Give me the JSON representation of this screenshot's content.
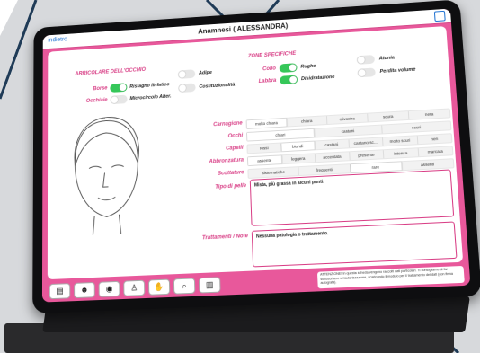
{
  "window": {
    "title": "Anamnesi ( ALESSANDRA)",
    "back_label": "indietro"
  },
  "sections": {
    "eye_area": "ARRICOLARE DELL'OCCHIO",
    "specific_zones": "ZONE SPECIFICHE"
  },
  "eye_toggles": [
    {
      "side_label": "Borse",
      "on": true,
      "label": "Ristagno linfatico"
    },
    {
      "side_label": "Occhiaie",
      "on": false,
      "label": "Microcircolo Alter."
    },
    {
      "side_label": "",
      "on": false,
      "label": "Adipe"
    },
    {
      "side_label": "",
      "on": false,
      "label": "Costituzionalità"
    }
  ],
  "zone_toggles": [
    {
      "side_label": "Collo",
      "on": true,
      "label": "Rughe"
    },
    {
      "side_label": "Labbra",
      "on": true,
      "label": "Disidratazione"
    },
    {
      "side_label": "",
      "on": false,
      "label": "Atonia"
    },
    {
      "side_label": "",
      "on": false,
      "label": "Perdita volume"
    }
  ],
  "rows": [
    {
      "label": "Carnagione",
      "options": [
        "molto chiara",
        "chiara",
        "olivastra",
        "scura",
        "nera"
      ],
      "selected": 0
    },
    {
      "label": "Occhi",
      "options": [
        "chiari",
        "castani",
        "scuri"
      ],
      "selected": 0
    },
    {
      "label": "Capelli",
      "options": [
        "rossi",
        "biondi",
        "castani",
        "castano sc...",
        "molto scuri",
        "neri"
      ],
      "selected": 1
    },
    {
      "label": "Abbronzatura",
      "options": [
        "assente",
        "leggera",
        "accentata",
        "presente",
        "intensa",
        "marcata"
      ],
      "selected": 0
    },
    {
      "label": "Scottature",
      "options": [
        "sistematiche",
        "frequenti",
        "rare",
        "assenti"
      ],
      "selected": 2
    }
  ],
  "skin_type": {
    "label": "Tipo di pelle",
    "value": "Mista, più grassa in alcuni punti."
  },
  "treatments": {
    "label": "Trattamenti / Note",
    "value": "Nessuna patologia o trattamento."
  },
  "toolbar_icons": [
    "document-icon",
    "head-icon",
    "eye-icon",
    "body-icon",
    "hands-icon",
    "search-face-icon",
    "book-icon"
  ],
  "notice": "ATTENZIONE! In questa scheda vengono raccolti dati particolari. Ti consigliamo di far sottoscrivere un'autorizzazione, scaricando il modulo per il trattamento dei dati (con firma autografa).",
  "colors": {
    "accent": "#e8589b",
    "toggle_on": "#35c759"
  }
}
